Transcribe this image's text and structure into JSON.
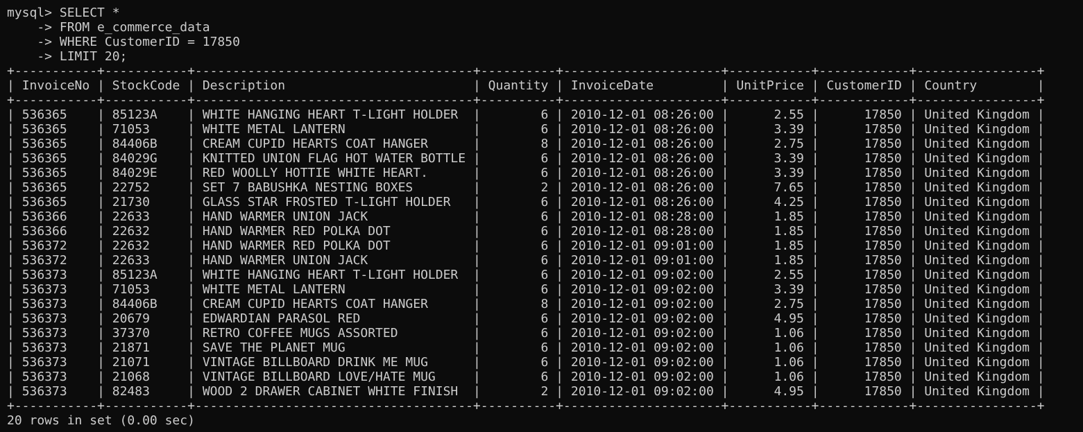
{
  "terminal": {
    "prompt": "mysql> ",
    "continuation": "    -> ",
    "query_lines": [
      "SELECT *",
      "FROM e_commerce_data",
      "WHERE CustomerID = 17850",
      "LIMIT 20;"
    ],
    "footer": "20 rows in set (0.00 sec)"
  },
  "table": {
    "columns": [
      "InvoiceNo",
      "StockCode",
      "Description",
      "Quantity",
      "InvoiceDate",
      "UnitPrice",
      "CustomerID",
      "Country"
    ],
    "align": [
      "left",
      "left",
      "left",
      "right",
      "left",
      "right",
      "right",
      "left"
    ],
    "rows": [
      [
        "536365",
        "85123A",
        "WHITE HANGING HEART T-LIGHT HOLDER",
        "6",
        "2010-12-01 08:26:00",
        "2.55",
        "17850",
        "United Kingdom"
      ],
      [
        "536365",
        "71053",
        "WHITE METAL LANTERN",
        "6",
        "2010-12-01 08:26:00",
        "3.39",
        "17850",
        "United Kingdom"
      ],
      [
        "536365",
        "84406B",
        "CREAM CUPID HEARTS COAT HANGER",
        "8",
        "2010-12-01 08:26:00",
        "2.75",
        "17850",
        "United Kingdom"
      ],
      [
        "536365",
        "84029G",
        "KNITTED UNION FLAG HOT WATER BOTTLE",
        "6",
        "2010-12-01 08:26:00",
        "3.39",
        "17850",
        "United Kingdom"
      ],
      [
        "536365",
        "84029E",
        "RED WOOLLY HOTTIE WHITE HEART.",
        "6",
        "2010-12-01 08:26:00",
        "3.39",
        "17850",
        "United Kingdom"
      ],
      [
        "536365",
        "22752",
        "SET 7 BABUSHKA NESTING BOXES",
        "2",
        "2010-12-01 08:26:00",
        "7.65",
        "17850",
        "United Kingdom"
      ],
      [
        "536365",
        "21730",
        "GLASS STAR FROSTED T-LIGHT HOLDER",
        "6",
        "2010-12-01 08:26:00",
        "4.25",
        "17850",
        "United Kingdom"
      ],
      [
        "536366",
        "22633",
        "HAND WARMER UNION JACK",
        "6",
        "2010-12-01 08:28:00",
        "1.85",
        "17850",
        "United Kingdom"
      ],
      [
        "536366",
        "22632",
        "HAND WARMER RED POLKA DOT",
        "6",
        "2010-12-01 08:28:00",
        "1.85",
        "17850",
        "United Kingdom"
      ],
      [
        "536372",
        "22632",
        "HAND WARMER RED POLKA DOT",
        "6",
        "2010-12-01 09:01:00",
        "1.85",
        "17850",
        "United Kingdom"
      ],
      [
        "536372",
        "22633",
        "HAND WARMER UNION JACK",
        "6",
        "2010-12-01 09:01:00",
        "1.85",
        "17850",
        "United Kingdom"
      ],
      [
        "536373",
        "85123A",
        "WHITE HANGING HEART T-LIGHT HOLDER",
        "6",
        "2010-12-01 09:02:00",
        "2.55",
        "17850",
        "United Kingdom"
      ],
      [
        "536373",
        "71053",
        "WHITE METAL LANTERN",
        "6",
        "2010-12-01 09:02:00",
        "3.39",
        "17850",
        "United Kingdom"
      ],
      [
        "536373",
        "84406B",
        "CREAM CUPID HEARTS COAT HANGER",
        "8",
        "2010-12-01 09:02:00",
        "2.75",
        "17850",
        "United Kingdom"
      ],
      [
        "536373",
        "20679",
        "EDWARDIAN PARASOL RED",
        "6",
        "2010-12-01 09:02:00",
        "4.95",
        "17850",
        "United Kingdom"
      ],
      [
        "536373",
        "37370",
        "RETRO COFFEE MUGS ASSORTED",
        "6",
        "2010-12-01 09:02:00",
        "1.06",
        "17850",
        "United Kingdom"
      ],
      [
        "536373",
        "21871",
        "SAVE THE PLANET MUG",
        "6",
        "2010-12-01 09:02:00",
        "1.06",
        "17850",
        "United Kingdom"
      ],
      [
        "536373",
        "21071",
        "VINTAGE BILLBOARD DRINK ME MUG",
        "6",
        "2010-12-01 09:02:00",
        "1.06",
        "17850",
        "United Kingdom"
      ],
      [
        "536373",
        "21068",
        "VINTAGE BILLBOARD LOVE/HATE MUG",
        "6",
        "2010-12-01 09:02:00",
        "1.06",
        "17850",
        "United Kingdom"
      ],
      [
        "536373",
        "82483",
        "WOOD 2 DRAWER CABINET WHITE FINISH",
        "2",
        "2010-12-01 09:02:00",
        "4.95",
        "17850",
        "United Kingdom"
      ]
    ]
  }
}
